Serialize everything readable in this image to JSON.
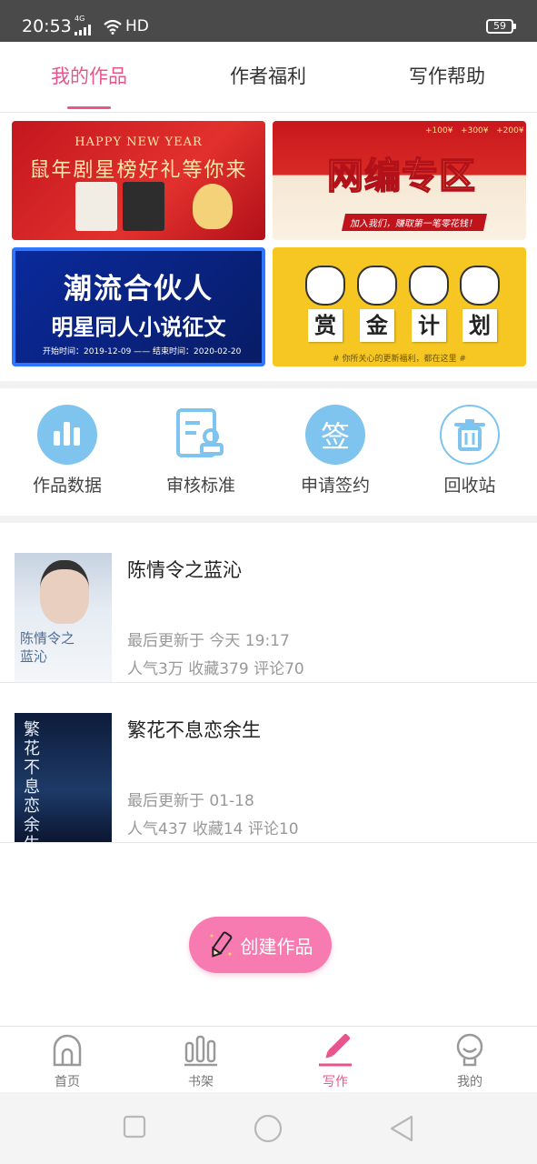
{
  "status_bar": {
    "time": "20:53",
    "network": "4G",
    "hd": "HD",
    "battery": "59"
  },
  "tabs": [
    {
      "label": "我的作品",
      "active": true
    },
    {
      "label": "作者福利",
      "active": false
    },
    {
      "label": "写作帮助",
      "active": false
    }
  ],
  "banners": {
    "b1": {
      "top": "HAPPY NEW YEAR",
      "title": "鼠年剧星榜好礼等你来"
    },
    "b2": {
      "title": "网编专区",
      "sub": "加入我们，赚取第一笔零花钱！",
      "bonus": [
        "+100¥",
        "+300¥",
        "+200¥"
      ]
    },
    "b3": {
      "title": "潮流合伙人",
      "sub": "明星同人小说征文",
      "dates": "开始时间：2019-12-09 —— 结束时间：2020-02-20"
    },
    "b4": {
      "words": [
        "赏",
        "金",
        "计",
        "划"
      ],
      "foot": "# 你所关心的更新福利，都在这里 #"
    }
  },
  "actions": [
    {
      "label": "作品数据",
      "icon": "bar-chart-icon"
    },
    {
      "label": "审核标准",
      "icon": "document-stamp-icon"
    },
    {
      "label": "申请签约",
      "icon": "sign-contract-icon"
    },
    {
      "label": "回收站",
      "icon": "trash-icon"
    }
  ],
  "works": [
    {
      "title": "陈情令之蓝沁",
      "updated": "最后更新于 今天 19:17",
      "stats": "人气3万  收藏379  评论70",
      "cover_text": "陈情令之蓝沁"
    },
    {
      "title": "繁花不息恋余生",
      "updated": "最后更新于 01-18",
      "stats": "人气437  收藏14  评论10",
      "cover_text": "繁花不息恋余生"
    }
  ],
  "create_button": "创建作品",
  "bottom_nav": [
    {
      "label": "首页",
      "icon": "home-icon",
      "active": false
    },
    {
      "label": "书架",
      "icon": "bookshelf-icon",
      "active": false
    },
    {
      "label": "写作",
      "icon": "pen-icon",
      "active": true
    },
    {
      "label": "我的",
      "icon": "profile-icon",
      "active": false
    }
  ],
  "colors": {
    "accent": "#e8558d",
    "action_icon": "#7ec4ee",
    "create_button": "#f77bb0"
  }
}
